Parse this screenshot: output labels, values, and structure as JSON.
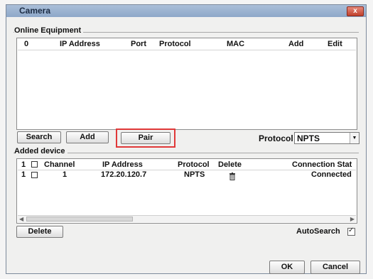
{
  "window": {
    "title": "Camera",
    "close_glyph": "x"
  },
  "online_equipment": {
    "label": "Online Equipment",
    "columns": [
      "0",
      "IP Address",
      "Port",
      "Protocol",
      "MAC",
      "Add",
      "Edit"
    ],
    "rows": []
  },
  "toolbar": {
    "search_label": "Search",
    "add_label": "Add",
    "pair_label": "Pair",
    "protocol_label": "Protocol",
    "protocol_value": "NPTS"
  },
  "added_device": {
    "label": "Added device",
    "header_index": "1",
    "columns": [
      "Channel",
      "IP Address",
      "Protocol",
      "Delete",
      "Connection Stat"
    ],
    "rows": [
      {
        "index": "1",
        "channel": "1",
        "ip": "172.20.120.7",
        "protocol": "NPTS",
        "status": "Connected"
      }
    ]
  },
  "bottom": {
    "delete_label": "Delete",
    "autosearch_label": "AutoSearch",
    "autosearch_checked": true,
    "ok_label": "OK",
    "cancel_label": "Cancel"
  },
  "icons": {
    "delete_row": "trash-icon",
    "scroll_left": "arrow-left-icon",
    "scroll_right": "arrow-right-icon"
  },
  "colors": {
    "highlight": "#e03838",
    "titlebar": "#9db4d2"
  }
}
